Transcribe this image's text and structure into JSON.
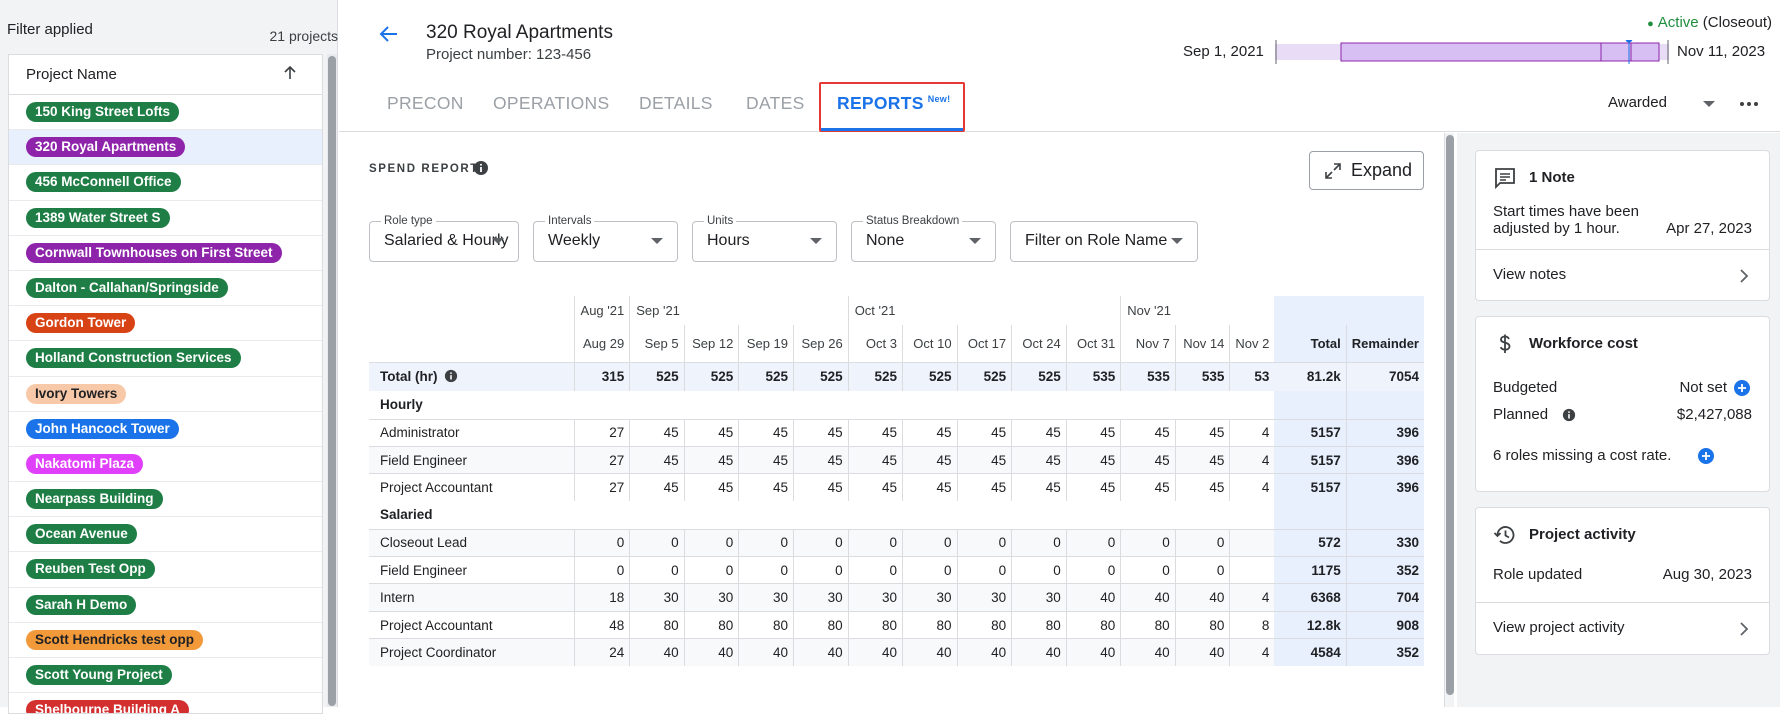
{
  "sidebar": {
    "filter_label": "Filter applied",
    "count_label": "21 projects",
    "header_label": "Project Name",
    "projects": [
      {
        "name": "150 King Street Lofts",
        "color": "#1e7e45"
      },
      {
        "name": "320 Royal Apartments",
        "color": "#8e24aa"
      },
      {
        "name": "456 McConnell Office",
        "color": "#1e7e45"
      },
      {
        "name": "1389 Water Street S",
        "color": "#1e7e45"
      },
      {
        "name": "Cornwall Townhouses on First Street",
        "color": "#8e24aa"
      },
      {
        "name": "Dalton - Callahan/Springside",
        "color": "#1e7e45"
      },
      {
        "name": "Gordon Tower",
        "color": "#d84315"
      },
      {
        "name": "Holland Construction Services",
        "color": "#1e7e45"
      },
      {
        "name": "Ivory Towers",
        "color": "#f8c9a8"
      },
      {
        "name": "John Hancock Tower",
        "color": "#1a73e8"
      },
      {
        "name": "Nakatomi Plaza",
        "color": "#e040fb"
      },
      {
        "name": "Nearpass Building",
        "color": "#1e7e45"
      },
      {
        "name": "Ocean Avenue",
        "color": "#1e7e45"
      },
      {
        "name": "Reuben Test Opp",
        "color": "#1e7e45"
      },
      {
        "name": "Sarah H Demo",
        "color": "#1e7e45"
      },
      {
        "name": "Scott Hendricks test opp",
        "color": "#f29a3a"
      },
      {
        "name": "Scott Young Project",
        "color": "#1e7e45"
      },
      {
        "name": "Shelbourne Building A",
        "color": "#d32f2f"
      }
    ]
  },
  "header": {
    "title": "320 Royal Apartments",
    "project_number": "Project number: 123-456",
    "status_active": "Active",
    "status_sub": "(Closeout)",
    "date_start": "Sep 1, 2021",
    "date_end": "Nov 11, 2023",
    "tabs": [
      "PRECON",
      "OPERATIONS",
      "DETAILS",
      "DATES",
      "REPORTS"
    ],
    "new_badge": "New!",
    "stage_select": "Awarded"
  },
  "report": {
    "title": "SPEND REPORT",
    "expand_label": "Expand",
    "filters": [
      {
        "label": "Role type",
        "value": "Salaried & Hourly"
      },
      {
        "label": "Intervals",
        "value": "Weekly"
      },
      {
        "label": "Units",
        "value": "Hours"
      },
      {
        "label": "Status Breakdown",
        "value": "None"
      },
      {
        "label": "",
        "value": "Filter on Role Name"
      }
    ],
    "months": [
      "Aug '21",
      "Sep '21",
      "Oct '21",
      "Nov '21"
    ],
    "weeks": [
      "Aug 29",
      "Sep 5",
      "Sep 12",
      "Sep 19",
      "Sep 26",
      "Oct 3",
      "Oct 10",
      "Oct 17",
      "Oct 24",
      "Oct 31",
      "Nov 7",
      "Nov 14",
      "Nov 2"
    ],
    "total_header": "Total",
    "remainder_header": "Remainder",
    "total_row": {
      "label": "Total (hr)",
      "values": [
        "315",
        "525",
        "525",
        "525",
        "525",
        "525",
        "525",
        "525",
        "525",
        "535",
        "535",
        "535",
        "53"
      ],
      "total": "81.2k",
      "remainder": "7054"
    },
    "sections": [
      {
        "label": "Hourly",
        "rows": [
          {
            "label": "Administrator",
            "values": [
              "27",
              "45",
              "45",
              "45",
              "45",
              "45",
              "45",
              "45",
              "45",
              "45",
              "45",
              "45",
              "4"
            ],
            "total": "5157",
            "remainder": "396"
          },
          {
            "label": "Field Engineer",
            "values": [
              "27",
              "45",
              "45",
              "45",
              "45",
              "45",
              "45",
              "45",
              "45",
              "45",
              "45",
              "45",
              "4"
            ],
            "total": "5157",
            "remainder": "396"
          },
          {
            "label": "Project Accountant",
            "values": [
              "27",
              "45",
              "45",
              "45",
              "45",
              "45",
              "45",
              "45",
              "45",
              "45",
              "45",
              "45",
              "4"
            ],
            "total": "5157",
            "remainder": "396"
          }
        ]
      },
      {
        "label": "Salaried",
        "rows": [
          {
            "label": "Closeout Lead",
            "values": [
              "0",
              "0",
              "0",
              "0",
              "0",
              "0",
              "0",
              "0",
              "0",
              "0",
              "0",
              "0",
              ""
            ],
            "total": "572",
            "remainder": "330"
          },
          {
            "label": "Field Engineer",
            "values": [
              "0",
              "0",
              "0",
              "0",
              "0",
              "0",
              "0",
              "0",
              "0",
              "0",
              "0",
              "0",
              ""
            ],
            "total": "1175",
            "remainder": "352"
          },
          {
            "label": "Intern",
            "values": [
              "18",
              "30",
              "30",
              "30",
              "30",
              "30",
              "30",
              "30",
              "30",
              "40",
              "40",
              "40",
              "4"
            ],
            "total": "6368",
            "remainder": "704"
          },
          {
            "label": "Project Accountant",
            "values": [
              "48",
              "80",
              "80",
              "80",
              "80",
              "80",
              "80",
              "80",
              "80",
              "80",
              "80",
              "80",
              "8"
            ],
            "total": "12.8k",
            "remainder": "908"
          },
          {
            "label": "Project Coordinator",
            "values": [
              "24",
              "40",
              "40",
              "40",
              "40",
              "40",
              "40",
              "40",
              "40",
              "40",
              "40",
              "40",
              "4"
            ],
            "total": "4584",
            "remainder": "352"
          }
        ]
      }
    ]
  },
  "notes_card": {
    "title": "1 Note",
    "text_line1": "Start times have been",
    "text_line2": "adjusted by 1 hour.",
    "date": "Apr 27, 2023",
    "link": "View notes"
  },
  "workforce_card": {
    "title": "Workforce cost",
    "budgeted_label": "Budgeted",
    "budgeted_value": "Not set",
    "planned_label": "Planned",
    "planned_value": "$2,427,088",
    "missing_text": "6 roles missing a cost rate."
  },
  "activity_card": {
    "title": "Project activity",
    "item_label": "Role updated",
    "item_date": "Aug 30, 2023",
    "link": "View project activity"
  },
  "colors": {
    "accent": "#1a73e8",
    "active_green": "#1e8e3e",
    "highlight_red": "#e53935",
    "timeline_purple": "#dcc6f5"
  }
}
